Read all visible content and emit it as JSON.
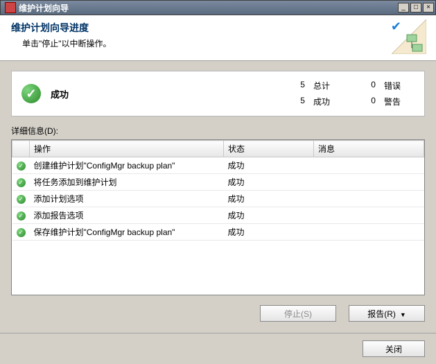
{
  "window": {
    "title": "维护计划向导"
  },
  "header": {
    "title": "维护计划向导进度",
    "subtitle": "单击\"停止\"以中断操作。"
  },
  "status": {
    "label": "成功",
    "total_num": "5",
    "total_label": "总计",
    "success_num": "5",
    "success_label": "成功",
    "error_num": "0",
    "error_label": "错误",
    "warn_num": "0",
    "warn_label": "警告"
  },
  "detail_label": "详细信息(D):",
  "columns": {
    "action": "操作",
    "status": "状态",
    "message": "消息"
  },
  "rows": [
    {
      "action": "创建维护计划\"ConfigMgr backup plan\"",
      "status": "成功",
      "message": ""
    },
    {
      "action": "将任务添加到维护计划",
      "status": "成功",
      "message": ""
    },
    {
      "action": "添加计划选项",
      "status": "成功",
      "message": ""
    },
    {
      "action": "添加报告选项",
      "status": "成功",
      "message": ""
    },
    {
      "action": "保存维护计划\"ConfigMgr backup plan\"",
      "status": "成功",
      "message": ""
    }
  ],
  "buttons": {
    "stop": "停止(S)",
    "report": "报告(R)",
    "close": "关闭"
  }
}
